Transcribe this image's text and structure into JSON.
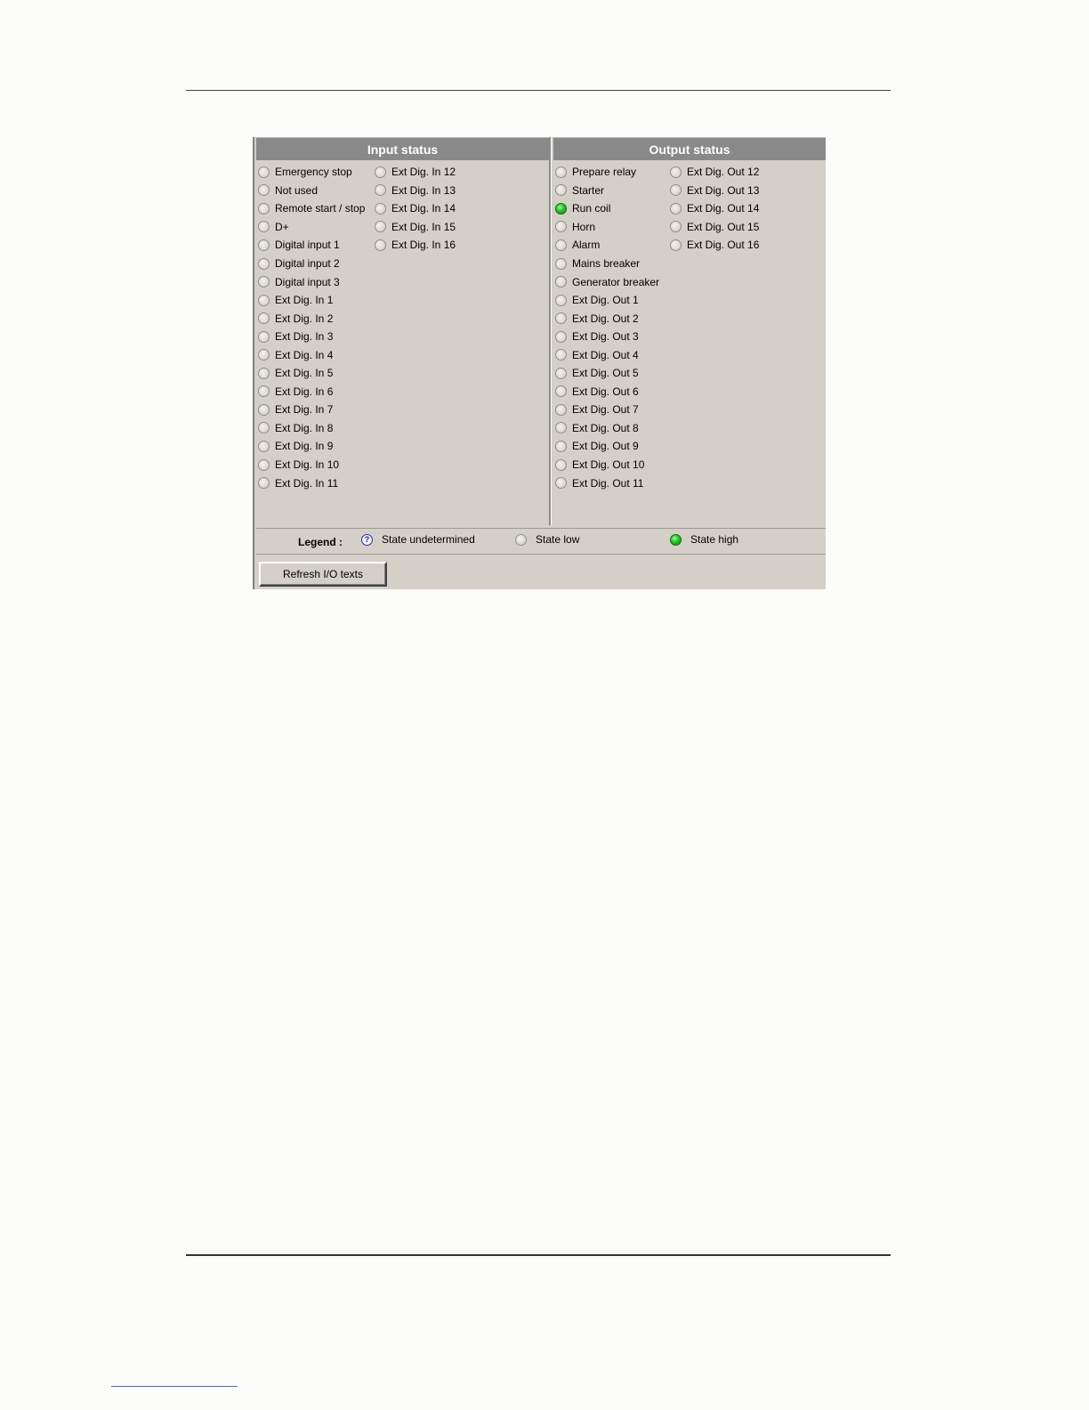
{
  "input_panel": {
    "title": "Input status",
    "col1": [
      {
        "label": "Emergency stop",
        "state": "low"
      },
      {
        "label": "Not used",
        "state": "low"
      },
      {
        "label": "Remote start / stop",
        "state": "low"
      },
      {
        "label": "D+",
        "state": "low"
      },
      {
        "label": "Digital input 1",
        "state": "low"
      },
      {
        "label": "Digital input 2",
        "state": "low"
      },
      {
        "label": "Digital input 3",
        "state": "low"
      },
      {
        "label": "Ext Dig. In 1",
        "state": "low"
      },
      {
        "label": "Ext Dig. In 2",
        "state": "low"
      },
      {
        "label": "Ext Dig. In 3",
        "state": "low"
      },
      {
        "label": "Ext Dig. In 4",
        "state": "low"
      },
      {
        "label": "Ext Dig. In 5",
        "state": "low"
      },
      {
        "label": "Ext Dig. In 6",
        "state": "low"
      },
      {
        "label": "Ext Dig. In 7",
        "state": "low"
      },
      {
        "label": "Ext Dig. In 8",
        "state": "low"
      },
      {
        "label": "Ext Dig. In 9",
        "state": "low"
      },
      {
        "label": "Ext Dig. In 10",
        "state": "low"
      },
      {
        "label": "Ext Dig. In 11",
        "state": "low"
      }
    ],
    "col2": [
      {
        "label": "Ext Dig. In 12",
        "state": "low"
      },
      {
        "label": "Ext Dig. In 13",
        "state": "low"
      },
      {
        "label": "Ext Dig. In 14",
        "state": "low"
      },
      {
        "label": "Ext Dig. In 15",
        "state": "low"
      },
      {
        "label": "Ext Dig. In 16",
        "state": "low"
      }
    ]
  },
  "output_panel": {
    "title": "Output status",
    "col1": [
      {
        "label": "Prepare relay",
        "state": "low"
      },
      {
        "label": "Starter",
        "state": "low"
      },
      {
        "label": "Run coil",
        "state": "high"
      },
      {
        "label": "Horn",
        "state": "low"
      },
      {
        "label": "Alarm",
        "state": "low"
      },
      {
        "label": "Mains breaker",
        "state": "low"
      },
      {
        "label": "Generator breaker",
        "state": "low"
      },
      {
        "label": "Ext Dig. Out 1",
        "state": "low"
      },
      {
        "label": "Ext Dig. Out 2",
        "state": "low"
      },
      {
        "label": "Ext Dig. Out 3",
        "state": "low"
      },
      {
        "label": "Ext Dig. Out 4",
        "state": "low"
      },
      {
        "label": "Ext Dig. Out 5",
        "state": "low"
      },
      {
        "label": "Ext Dig. Out 6",
        "state": "low"
      },
      {
        "label": "Ext Dig. Out 7",
        "state": "low"
      },
      {
        "label": "Ext Dig. Out 8",
        "state": "low"
      },
      {
        "label": "Ext Dig. Out 9",
        "state": "low"
      },
      {
        "label": "Ext Dig. Out 10",
        "state": "low"
      },
      {
        "label": "Ext Dig. Out 11",
        "state": "low"
      }
    ],
    "col2": [
      {
        "label": "Ext Dig. Out 12",
        "state": "low"
      },
      {
        "label": "Ext Dig. Out 13",
        "state": "low"
      },
      {
        "label": "Ext Dig. Out 14",
        "state": "low"
      },
      {
        "label": "Ext Dig. Out 15",
        "state": "low"
      },
      {
        "label": "Ext Dig. Out 16",
        "state": "low"
      }
    ]
  },
  "legend": {
    "title": "Legend :",
    "undetermined_icon_glyph": "?",
    "undetermined": "State undetermined",
    "low": "State low",
    "high": "State high"
  },
  "refresh_button": {
    "label": "Refresh I/O texts"
  },
  "colors": {
    "panel_bg": "#d4d0c8",
    "header_bg": "#898989",
    "state_high": "#27c227",
    "state_undetermined": "#2020a0"
  }
}
